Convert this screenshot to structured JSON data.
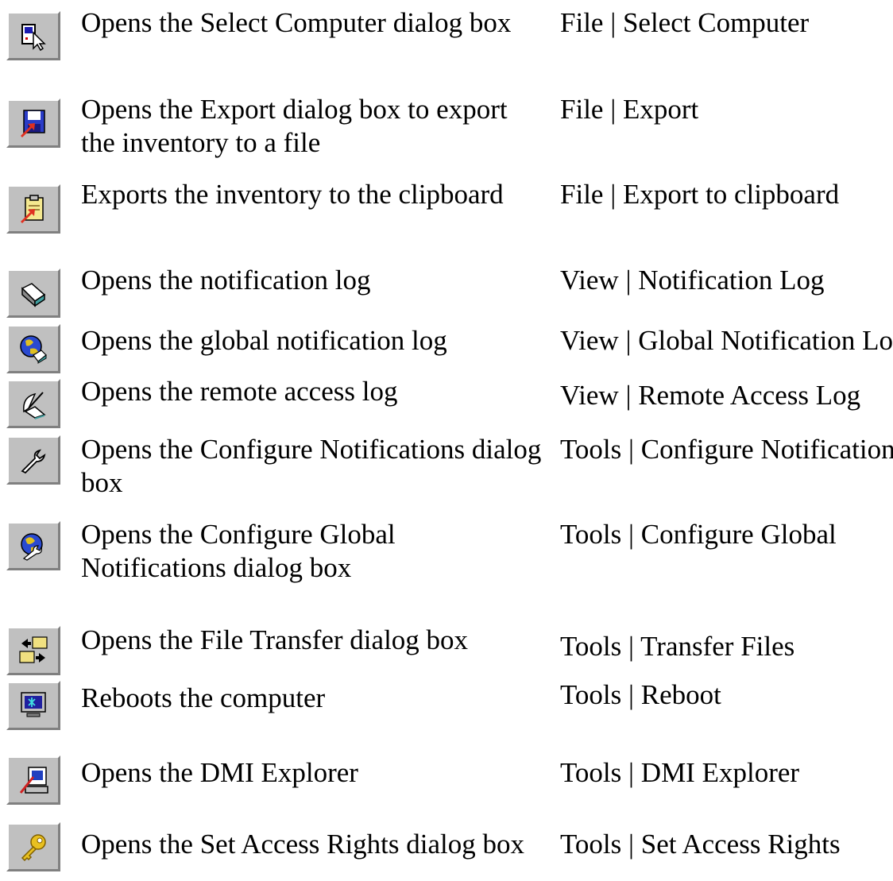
{
  "rows": [
    {
      "icon": "select-computer-icon",
      "description": "Opens the Select Computer dialog box",
      "menu_path": "File | Select Computer"
    },
    {
      "icon": "export-floppy-icon",
      "description": "Opens the Export dialog box to export the inventory to a file",
      "menu_path": "File | Export"
    },
    {
      "icon": "export-clipboard-icon",
      "description": "Exports the inventory to the clipboard",
      "menu_path": "File | Export to clipboard"
    },
    {
      "icon": "notification-log-icon",
      "description": "Opens the notification log",
      "menu_path": "View | Notification Log"
    },
    {
      "icon": "global-notification-log-icon",
      "description": "Opens the global notification log",
      "menu_path": "View | Global Notification Log"
    },
    {
      "icon": "remote-access-log-icon",
      "description": "Opens the remote access log",
      "menu_path": "View | Remote Access Log"
    },
    {
      "icon": "configure-notifications-wrench-icon",
      "description": "Opens the Configure Notifications dialog box",
      "menu_path": "Tools | Configure Notifications"
    },
    {
      "icon": "configure-global-notifications-icon",
      "description": "Opens the Configure Global Notifications dialog box",
      "menu_path": "Tools | Configure Global"
    },
    {
      "icon": "file-transfer-icon",
      "description": "Opens the File Transfer dialog box",
      "menu_path": "Tools | Transfer Files"
    },
    {
      "icon": "reboot-monitor-icon",
      "description": "Reboots the computer",
      "menu_path": "Tools | Reboot"
    },
    {
      "icon": "dmi-explorer-icon",
      "description": "Opens the DMI Explorer",
      "menu_path": "Tools | DMI Explorer"
    },
    {
      "icon": "access-rights-key-icon",
      "description": "Opens the Set Access Rights dialog box",
      "menu_path": "Tools | Set Access Rights"
    }
  ]
}
